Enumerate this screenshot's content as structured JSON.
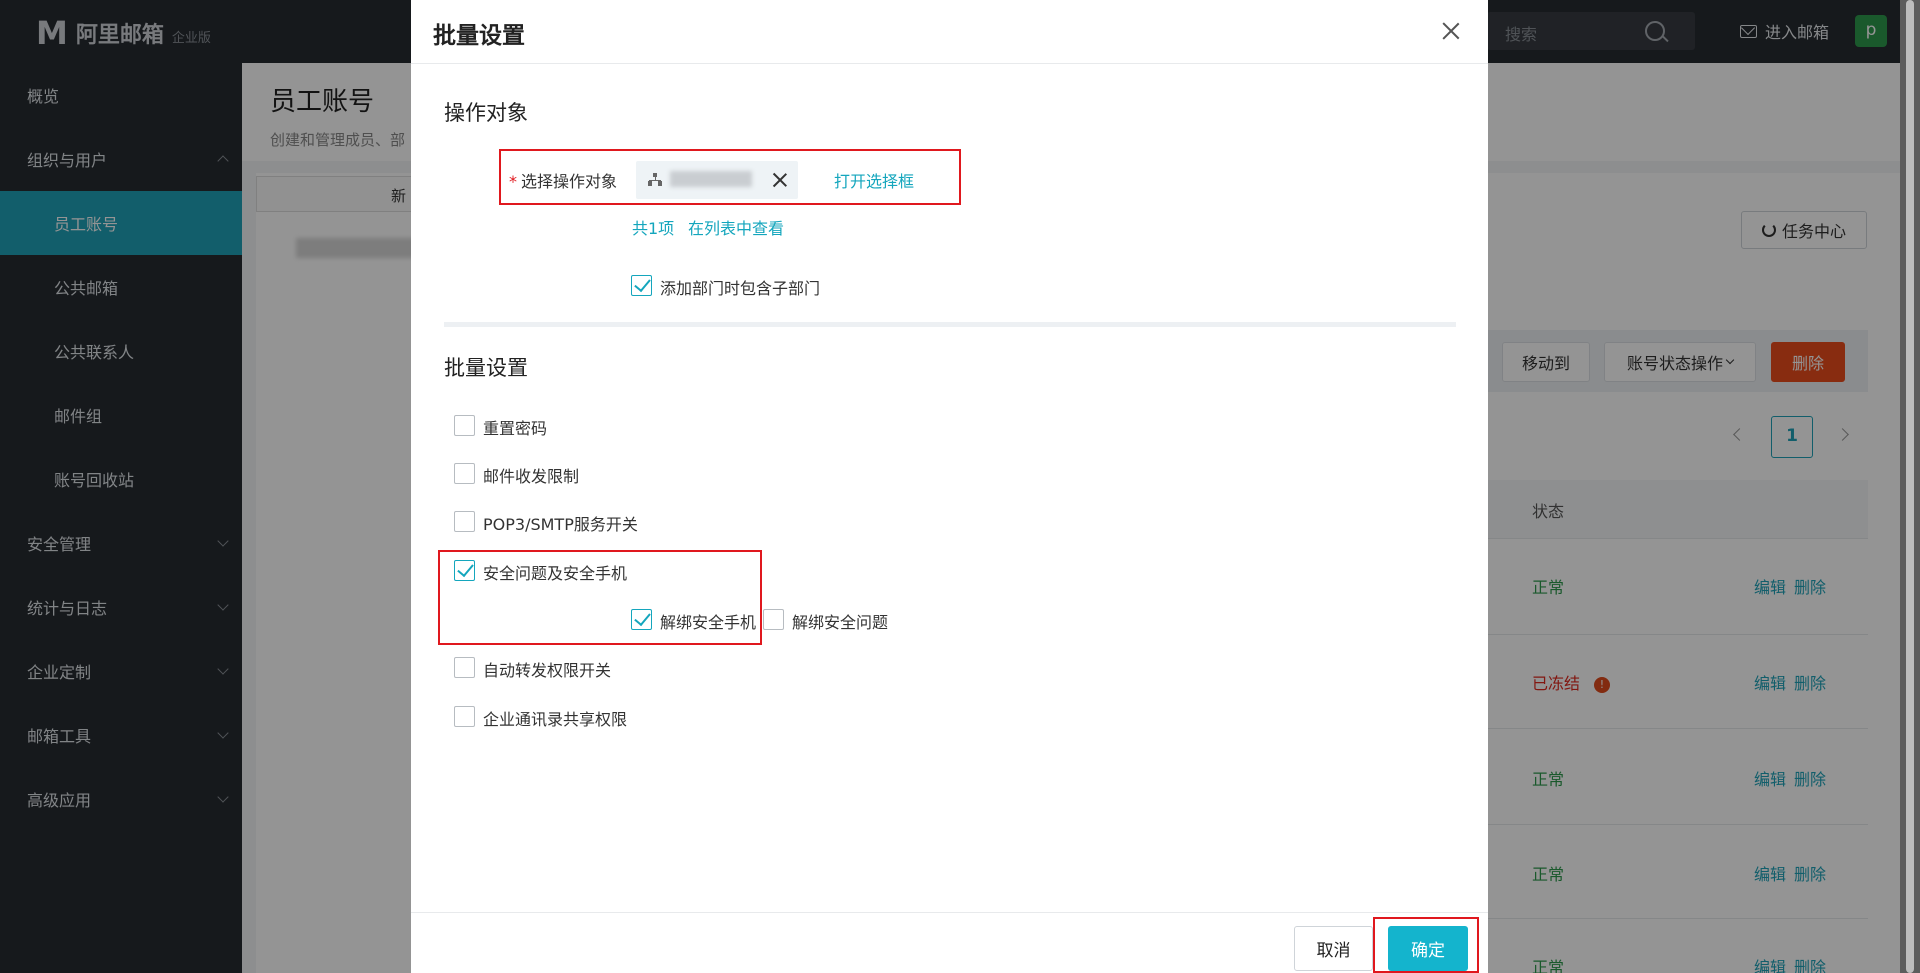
{
  "app": {
    "logo_mark": "M",
    "logo_text": "阿里邮箱",
    "edition": "企业版",
    "search_placeholder": "搜索",
    "enter_mail": "进入邮箱",
    "avatar_letter": "p"
  },
  "sidebar": {
    "items": [
      {
        "label": "概览"
      },
      {
        "label": "组织与用户"
      },
      {
        "label": "员工账号"
      },
      {
        "label": "公共邮箱"
      },
      {
        "label": "公共联系人"
      },
      {
        "label": "邮件组"
      },
      {
        "label": "账号回收站"
      },
      {
        "label": "安全管理"
      },
      {
        "label": "统计与日志"
      },
      {
        "label": "企业定制"
      },
      {
        "label": "邮箱工具"
      },
      {
        "label": "高级应用"
      }
    ]
  },
  "page": {
    "title": "员工账号",
    "subtitle": "创建和管理成员、部",
    "new_btn": "新",
    "task_center": "任务中心",
    "toolbar": {
      "move_to": "移动到",
      "status_ops": "账号状态操作",
      "delete": "删除"
    },
    "pager_current": "1",
    "col_status": "状态",
    "rows": [
      {
        "status": "正常",
        "edit": "编辑",
        "delete": "删除"
      },
      {
        "status": "已冻结",
        "edit": "编辑",
        "delete": "删除"
      },
      {
        "status": "正常",
        "edit": "编辑",
        "delete": "删除"
      },
      {
        "status": "正常",
        "edit": "编辑",
        "delete": "删除"
      },
      {
        "status": "正常",
        "edit": "编辑",
        "delete": "删除"
      }
    ],
    "warn_mark": "!"
  },
  "modal": {
    "title": "批量设置",
    "section_target": "操作对象",
    "target_label": "选择操作对象",
    "required_mark": "*",
    "open_selector": "打开选择框",
    "count_text": "共1项",
    "view_in_list": "在列表中查看",
    "include_sub": {
      "label": "添加部门时包含子部门",
      "checked": true
    },
    "section_batch": "批量设置",
    "options": [
      {
        "label": "重置密码",
        "checked": false
      },
      {
        "label": "邮件收发限制",
        "checked": false
      },
      {
        "label": "POP3/SMTP服务开关",
        "checked": false
      },
      {
        "label": "安全问题及安全手机",
        "checked": true
      },
      {
        "label": "自动转发权限开关",
        "checked": false
      },
      {
        "label": "企业通讯录共享权限",
        "checked": false
      }
    ],
    "sub_options": [
      {
        "label": "解绑安全手机",
        "checked": true
      },
      {
        "label": "解绑安全问题",
        "checked": false
      }
    ],
    "cancel": "取消",
    "confirm": "确定"
  },
  "colors": {
    "accent": "#14a6bd",
    "highlight_box": "#e0181e",
    "sidebar_bg": "#262b31",
    "danger": "#ea4c1d"
  }
}
